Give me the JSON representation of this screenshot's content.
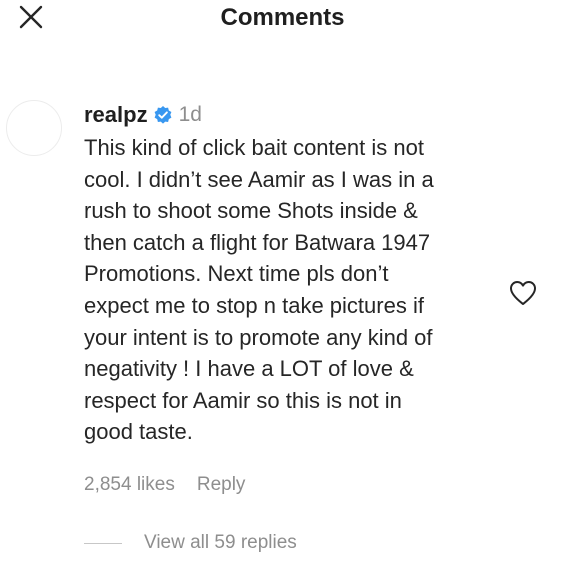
{
  "header": {
    "title": "Comments",
    "close_icon": "close-icon"
  },
  "comment": {
    "username": "realpz",
    "verified_icon": "verified-badge-icon",
    "verified_color": "#3897f0",
    "timestamp": "1d",
    "text_lines": [
      "This kind of click bait content is not",
      "cool. I didn’t see Aamir as I was in a",
      "rush to shoot some Shots inside &",
      "then catch a flight for Batwara 1947",
      "Promotions. Next time pls don’t",
      "expect me to stop n take pictures if",
      "your intent is to promote any kind of",
      "negativity ! I have a LOT of love &",
      "respect for Aamir so this is not in",
      "good taste."
    ],
    "likes": "2,854 likes",
    "reply_label": "Reply",
    "like_icon": "heart-outline-icon",
    "view_replies_label": "View all 59 replies"
  }
}
